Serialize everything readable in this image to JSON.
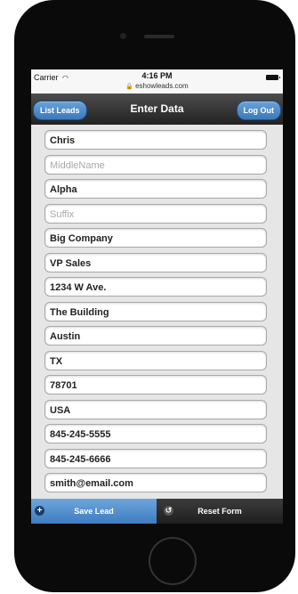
{
  "status": {
    "carrier": "Carrier",
    "time": "4:16 PM",
    "url": "eshowleads.com"
  },
  "navbar": {
    "left_button": "List Leads",
    "title": "Enter Data",
    "right_button": "Log Out"
  },
  "form": {
    "fields": [
      {
        "value": "Chris",
        "placeholder": ""
      },
      {
        "value": "",
        "placeholder": "MiddleName"
      },
      {
        "value": "Alpha",
        "placeholder": ""
      },
      {
        "value": "",
        "placeholder": "Suffix"
      },
      {
        "value": "Big Company",
        "placeholder": ""
      },
      {
        "value": "VP Sales",
        "placeholder": ""
      },
      {
        "value": "1234 W Ave.",
        "placeholder": ""
      },
      {
        "value": "The Building",
        "placeholder": ""
      },
      {
        "value": "Austin",
        "placeholder": ""
      },
      {
        "value": "TX",
        "placeholder": ""
      },
      {
        "value": "78701",
        "placeholder": ""
      },
      {
        "value": "USA",
        "placeholder": ""
      },
      {
        "value": "845-245-5555",
        "placeholder": ""
      },
      {
        "value": "845-245-6666",
        "placeholder": ""
      },
      {
        "value": "smith@email.com",
        "placeholder": ""
      }
    ]
  },
  "footer": {
    "save_label": "Save Lead",
    "reset_label": "Reset Form"
  },
  "colors": {
    "accent": "#3d7cc0",
    "navbar": "#2b2b2b"
  }
}
